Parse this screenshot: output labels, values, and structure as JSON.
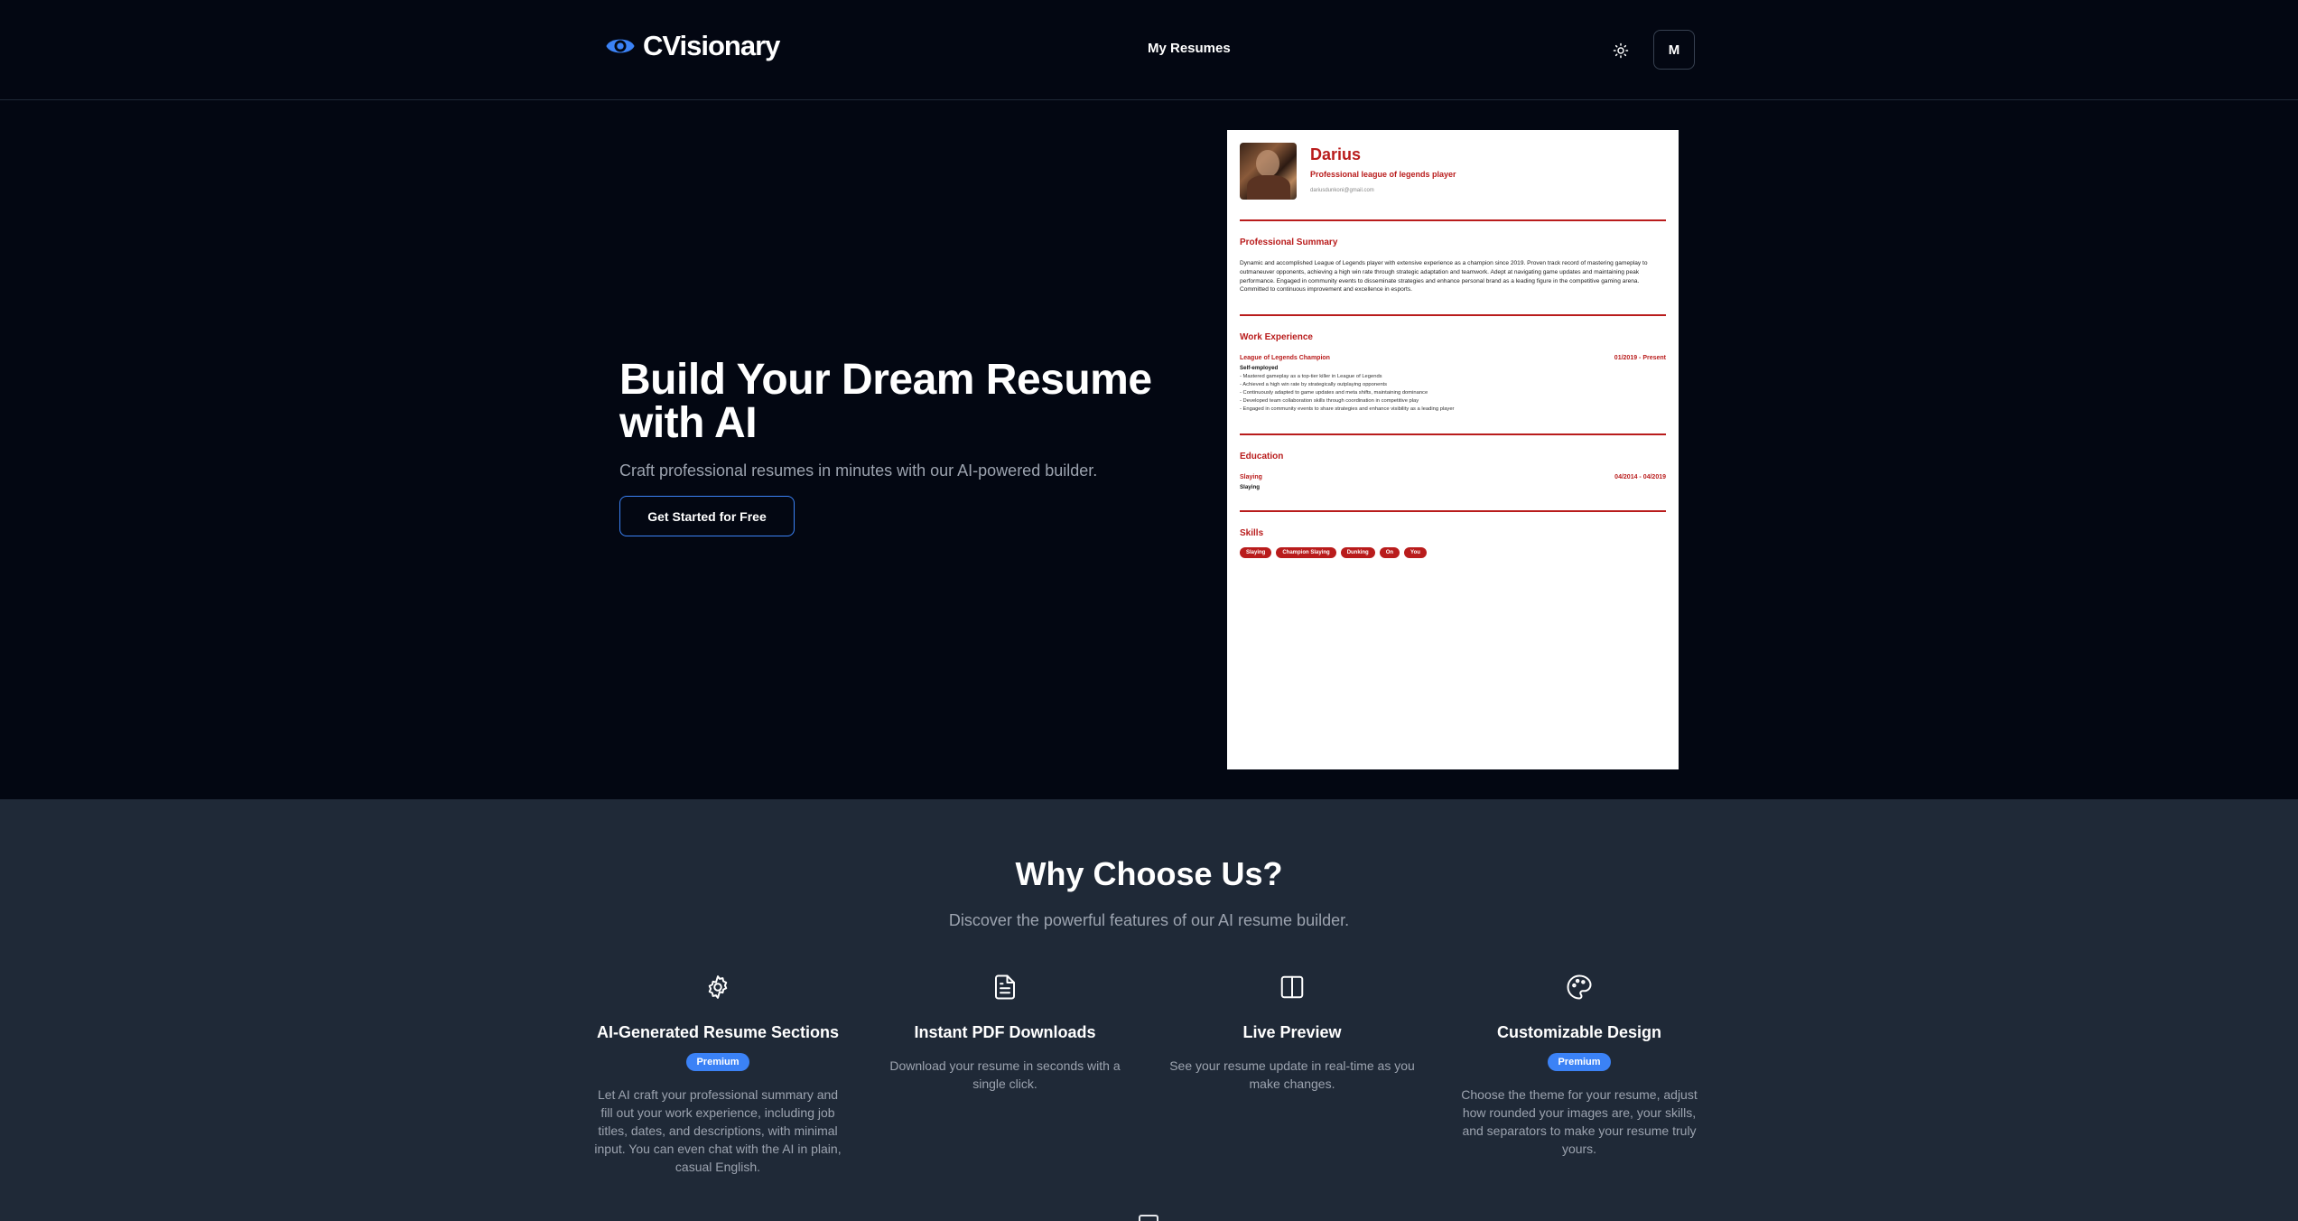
{
  "header": {
    "brand": "CVisionary",
    "nav_my_resumes": "My Resumes",
    "user_initial": "M"
  },
  "hero": {
    "title": "Build Your Dream Resume with AI",
    "subtitle": "Craft professional resumes in minutes with our AI-powered builder.",
    "cta": "Get Started for Free"
  },
  "resume": {
    "name": "Darius",
    "role": "Professional league of legends player",
    "email": "dariusdunkoni@gmail.com",
    "summary_heading": "Professional Summary",
    "summary": "Dynamic and accomplished League of Legends player with extensive experience as a champion since 2019. Proven track record of mastering gameplay to outmaneuver opponents, achieving a high win rate through strategic adaptation and teamwork. Adept at navigating game updates and maintaining peak performance. Engaged in community events to disseminate strategies and enhance personal brand as a leading figure in the competitive gaming arena. Committed to continuous improvement and excellence in esports.",
    "work_heading": "Work Experience",
    "job_title": "League of Legends Champion",
    "job_dates": "01/2019 - Present",
    "company": "Self-employed",
    "bullets": [
      "- Mastered gameplay as a top-tier killer in League of Legends",
      "- Achieved a high win rate by strategically outplaying opponents",
      "- Continuously adapted to game updates and meta shifts, maintaining dominance",
      "- Developed team collaboration skills through coordination in competitive play",
      "- Engaged in community events to share strategies and enhance visibility as a leading player"
    ],
    "education_heading": "Education",
    "edu_title": "Slaying",
    "edu_dates": "04/2014 - 04/2019",
    "edu_school": "Slaying",
    "skills_heading": "Skills",
    "skills": [
      "Slaying",
      "Champion Slaying",
      "Dunking",
      "On",
      "You"
    ]
  },
  "features": {
    "title": "Why Choose Us?",
    "subtitle": "Discover the powerful features of our AI resume builder.",
    "items": [
      {
        "name": "AI-Generated Resume Sections",
        "badge": "Premium",
        "icon": "ai-cog-icon",
        "desc": "Let AI craft your professional summary and fill out your work experience, including job titles, dates, and descriptions, with minimal input. You can even chat with the AI in plain, casual English."
      },
      {
        "name": "Instant PDF Downloads",
        "badge": "",
        "icon": "document-icon",
        "desc": "Download your resume in seconds with a single click."
      },
      {
        "name": "Live Preview",
        "badge": "",
        "icon": "split-panel-icon",
        "desc": "See your resume update in real-time as you make changes."
      },
      {
        "name": "Customizable Design",
        "badge": "Premium",
        "icon": "palette-icon",
        "desc": "Choose the theme for your resume, adjust how rounded your images are, your skills, and separators to make your resume truly yours."
      }
    ]
  },
  "colors": {
    "background": "#030712",
    "features_bg": "#1f2937",
    "accent": "#3b82f6",
    "resume_red": "#b91c1c"
  }
}
